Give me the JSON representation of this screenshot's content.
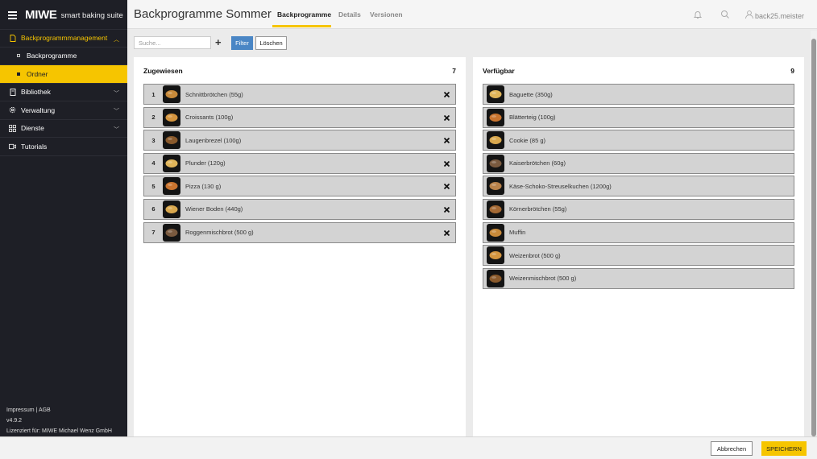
{
  "brand": {
    "logo": "MIWE",
    "tagline": "smart baking suite"
  },
  "sidebar": {
    "items": [
      {
        "label": "Backprogrammmanagement",
        "icon": "file-icon"
      },
      {
        "label": "Backprogramme",
        "icon": "square-bullet-icon"
      },
      {
        "label": "Ordner",
        "icon": "square-bullet-icon"
      },
      {
        "label": "Bibliothek",
        "icon": "book-icon"
      },
      {
        "label": "Verwaltung",
        "icon": "gear-icon"
      },
      {
        "label": "Dienste",
        "icon": "grid-icon"
      },
      {
        "label": "Tutorials",
        "icon": "video-icon"
      }
    ],
    "footer": {
      "links": "Impressum | AGB",
      "version": "v4.9.2",
      "license": "Lizenziert für: MIWE Michael Wenz GmbH"
    }
  },
  "header": {
    "title": "Backprogramme Sommer",
    "tabs": [
      "Backprogramme",
      "Details",
      "Versionen"
    ],
    "username": "back25.meister"
  },
  "toolbar": {
    "search_placeholder": "Suche...",
    "add_label": "+",
    "filter_label": "Filter",
    "clear_label": "Löschen"
  },
  "assigned": {
    "title": "Zugewiesen",
    "count": "7",
    "items": [
      {
        "num": "1",
        "name": "Schnittbrötchen (55g)"
      },
      {
        "num": "2",
        "name": "Croissants (100g)"
      },
      {
        "num": "3",
        "name": "Laugenbrezel (100g)"
      },
      {
        "num": "4",
        "name": "Plunder (120g)"
      },
      {
        "num": "5",
        "name": "Pizza (130 g)"
      },
      {
        "num": "6",
        "name": "Wiener Boden (440g)"
      },
      {
        "num": "7",
        "name": "Roggenmischbrot (500 g)"
      }
    ]
  },
  "available": {
    "title": "Verfügbar",
    "count": "9",
    "items": [
      {
        "name": "Baguette (350g)"
      },
      {
        "name": "Blätterteig (100g)"
      },
      {
        "name": "Cookie (85 g)"
      },
      {
        "name": "Kaiserbrötchen (60g)"
      },
      {
        "name": "Käse-Schoko-Streuselkuchen (1200g)"
      },
      {
        "name": "Körnerbrötchen (55g)"
      },
      {
        "name": "Muffin"
      },
      {
        "name": "Weizenbrot (500 g)"
      },
      {
        "name": "Weizenmischbrot (500 g)"
      }
    ]
  },
  "footer": {
    "cancel_label": "Abbrechen",
    "save_label": "SPEICHERN"
  },
  "colors": {
    "accent": "#f6c500",
    "sidebar_bg": "#1e1f26",
    "filter_blue": "#4a86c5"
  }
}
